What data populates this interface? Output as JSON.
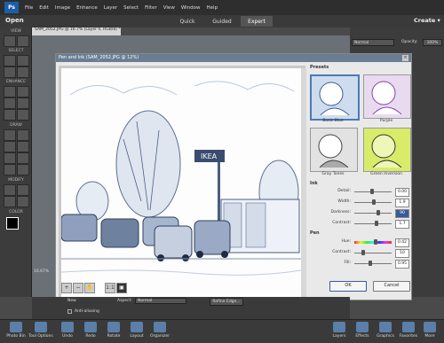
{
  "menubar": {
    "logo": "Ps",
    "items": [
      "File",
      "Edit",
      "Image",
      "Enhance",
      "Layer",
      "Select",
      "Filter",
      "View",
      "Window",
      "Help"
    ]
  },
  "modebar": {
    "open_label": "Open",
    "modes": [
      "Quick",
      "Guided",
      "Expert"
    ],
    "active_mode": "Expert",
    "create_label": "Create ▾"
  },
  "toolbar": {
    "sections": [
      "VIEW",
      "SELECT",
      "ENHANCE",
      "DRAW",
      "MODIFY",
      "COLOR"
    ]
  },
  "document": {
    "tab_title": "SAM_2052.JPG @ 16.7% (Layer 0, RGB/8) *",
    "zoom": "16.67%"
  },
  "layers_panel": {
    "blend_mode": "Normal",
    "opacity_label": "Opacity:",
    "opacity_value": "100%"
  },
  "dialog": {
    "title": "Pen and Ink (SAM_2052.JPG @ 12%)",
    "presets_label": "Presets",
    "presets": [
      {
        "name": "Basic Blue",
        "tint": "#6f8fbf"
      },
      {
        "name": "Purple",
        "tint": "#9a5fb3"
      },
      {
        "name": "Gray Tones",
        "tint": "#888888"
      },
      {
        "name": "Green Inversion",
        "tint": "#cbe35a"
      }
    ],
    "ink_label": "Ink",
    "ink": [
      {
        "label": "Detail:",
        "value": "0.00",
        "pos": 0.45
      },
      {
        "label": "Width:",
        "value": "1.9",
        "pos": 0.5
      },
      {
        "label": "Darkness:",
        "value": "90",
        "pos": 0.6
      },
      {
        "label": "Contrast:",
        "value": "1.7",
        "pos": 0.55
      }
    ],
    "pen_label": "Pen",
    "pen": [
      {
        "label": "Hue:",
        "value": "0.42",
        "pos": 0.55
      },
      {
        "label": "Contrast:",
        "value": "10",
        "pos": 0.2
      },
      {
        "label": "Fill:",
        "value": "0.95",
        "pos": 0.4
      }
    ],
    "ok_label": "OK",
    "cancel_label": "Cancel",
    "sign_text": "IKEA"
  },
  "options_bar": {
    "new_label": "New",
    "antialiasing_label": "Anti-aliasing",
    "aspect_label": "Aspect:",
    "aspect_value": "Normal",
    "refine_edge_label": "Refine Edge..."
  },
  "bottombar": {
    "items": [
      "Photo Bin",
      "Tool Options",
      "Undo",
      "Redo",
      "Rotate",
      "Layout",
      "Organizer",
      "Layers",
      "Effects",
      "Graphics",
      "Favorites",
      "More"
    ]
  },
  "colors": {
    "accent": "#1a5fa8",
    "dialog_title": "#6b7d92"
  }
}
